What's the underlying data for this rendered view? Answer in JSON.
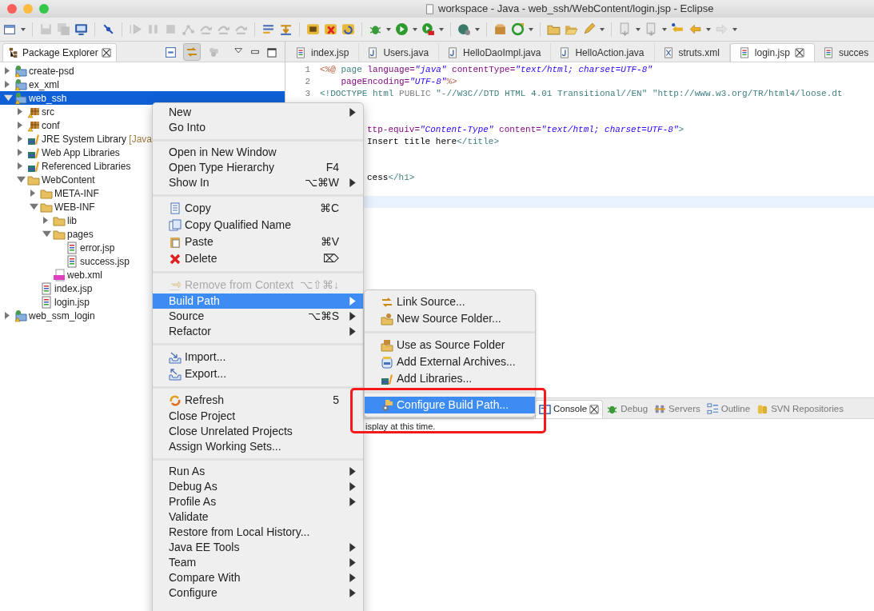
{
  "window": {
    "title": "workspace - Java - web_ssh/WebContent/login.jsp - Eclipse"
  },
  "package_explorer": {
    "title": "Package Explorer",
    "link_with_editor_on": true,
    "tree": [
      {
        "label": "create-psd",
        "kind": "project",
        "expanded": false,
        "selected": false
      },
      {
        "label": "ex_xml",
        "kind": "project",
        "expanded": false,
        "selected": false
      },
      {
        "label": "web_ssh",
        "kind": "project",
        "expanded": true,
        "selected": true,
        "children": [
          {
            "label": "src",
            "kind": "package-folder",
            "expanded": false,
            "selected": false
          },
          {
            "label": "conf",
            "kind": "package-folder",
            "expanded": false,
            "selected": false
          },
          {
            "label": "JRE System Library",
            "note": "[Java",
            "kind": "library",
            "expanded": false,
            "selected": false
          },
          {
            "label": "Web App Libraries",
            "kind": "library",
            "expanded": false,
            "selected": false
          },
          {
            "label": "Referenced Libraries",
            "kind": "library",
            "expanded": false,
            "selected": false
          },
          {
            "label": "WebContent",
            "kind": "folder",
            "expanded": true,
            "selected": false,
            "children": [
              {
                "label": "META-INF",
                "kind": "folder",
                "expanded": false,
                "selected": false
              },
              {
                "label": "WEB-INF",
                "kind": "folder",
                "expanded": true,
                "selected": false,
                "children": [
                  {
                    "label": "lib",
                    "kind": "folder",
                    "expanded": false,
                    "selected": false
                  },
                  {
                    "label": "pages",
                    "kind": "folder",
                    "expanded": true,
                    "selected": false,
                    "children": [
                      {
                        "label": "error.jsp",
                        "kind": "jsp",
                        "selected": false
                      },
                      {
                        "label": "success.jsp",
                        "kind": "jsp",
                        "selected": false
                      }
                    ]
                  },
                  {
                    "label": "web.xml",
                    "kind": "xml",
                    "selected": false
                  }
                ]
              },
              {
                "label": "index.jsp",
                "kind": "jsp",
                "selected": false
              },
              {
                "label": "login.jsp",
                "kind": "jsp",
                "selected": false
              }
            ]
          }
        ]
      },
      {
        "label": "web_ssm_login",
        "kind": "project",
        "expanded": false,
        "selected": false
      }
    ]
  },
  "editor": {
    "tabs": [
      {
        "label": "index.jsp",
        "kind": "jsp",
        "selected": false
      },
      {
        "label": "Users.java",
        "kind": "java",
        "selected": false
      },
      {
        "label": "HelloDaoImpl.java",
        "kind": "java",
        "selected": false
      },
      {
        "label": "HelloAction.java",
        "kind": "java",
        "selected": false
      },
      {
        "label": "struts.xml",
        "kind": "xml",
        "selected": false
      },
      {
        "label": "login.jsp",
        "kind": "jsp",
        "selected": true
      },
      {
        "label": "succes",
        "kind": "jsp",
        "selected": false
      }
    ],
    "lines": [
      {
        "number": "1",
        "kind": "full",
        "current": false,
        "tokens": [
          {
            "text": "<%@",
            "kind": "directive"
          },
          {
            "text": " page",
            "kind": "tag"
          },
          {
            "text": " language=",
            "kind": "attr"
          },
          {
            "text": "\"java\"",
            "kind": "value"
          },
          {
            "text": " contentType=",
            "kind": "attr"
          },
          {
            "text": "\"text/html; charset=UTF-8\"",
            "kind": "value"
          }
        ]
      },
      {
        "number": "2",
        "kind": "full",
        "current": false,
        "tokens": [
          {
            "text": "    pageEncoding=",
            "kind": "attr"
          },
          {
            "text": "\"UTF-8\"",
            "kind": "value"
          },
          {
            "text": "%>",
            "kind": "directive"
          }
        ]
      },
      {
        "number": "3",
        "kind": "full",
        "current": false,
        "tokens": [
          {
            "text": "<!DOCTYPE html ",
            "kind": "tag"
          },
          {
            "text": "PUBLIC",
            "kind": "keyword"
          },
          {
            "text": " \"-//W3C//DTD HTML 4.01 Transitional//EN\" \"http://www.w3.org/TR/html4/loose.dt",
            "kind": "tag"
          }
        ]
      },
      {
        "kind": "blank",
        "current": false
      },
      {
        "kind": "blank",
        "current": false
      },
      {
        "kind": "partial",
        "current": false,
        "tokens": [
          {
            "text": "ttp-equiv=",
            "kind": "attr"
          },
          {
            "text": "\"Content-Type\"",
            "kind": "value"
          },
          {
            "text": " content=",
            "kind": "attr"
          },
          {
            "text": "\"text/html; charset=UTF-8\"",
            "kind": "value"
          },
          {
            "text": ">",
            "kind": "tag"
          }
        ]
      },
      {
        "kind": "partial",
        "current": false,
        "tokens": [
          {
            "text": "Insert title here",
            "kind": "plain"
          },
          {
            "text": "</title>",
            "kind": "tag"
          }
        ]
      },
      {
        "kind": "blank",
        "current": false
      },
      {
        "kind": "blank",
        "current": false
      },
      {
        "kind": "partial",
        "current": false,
        "tokens": [
          {
            "text": "cess",
            "kind": "plain"
          },
          {
            "text": "</h1>",
            "kind": "tag"
          }
        ]
      },
      {
        "kind": "blank",
        "current": false
      },
      {
        "kind": "blank",
        "current": true
      }
    ]
  },
  "bottom_panel": {
    "tabs": [
      {
        "label": "Console",
        "kind": "console",
        "selected": true
      },
      {
        "label": "Debug",
        "kind": "debug",
        "selected": false
      },
      {
        "label": "Servers",
        "kind": "servers",
        "selected": false
      },
      {
        "label": "Outline",
        "kind": "outline",
        "selected": false
      },
      {
        "label": "SVN Repositories",
        "kind": "svn",
        "selected": false
      }
    ],
    "message": "isplay at this time."
  },
  "context_menu": {
    "groups": [
      [
        {
          "label": "New",
          "submenu": true,
          "disabled": false,
          "selected": false
        },
        {
          "label": "Go Into",
          "submenu": false,
          "disabled": false,
          "selected": false
        }
      ],
      [
        {
          "label": "Open in New Window",
          "submenu": false,
          "disabled": false,
          "selected": false
        },
        {
          "label": "Open Type Hierarchy",
          "shortcut": "F4",
          "submenu": false,
          "disabled": false,
          "selected": false
        },
        {
          "label": "Show In",
          "shortcut": "⌥⌘W",
          "submenu": true,
          "disabled": false,
          "selected": false
        }
      ],
      [
        {
          "label": "Copy",
          "shortcut": "⌘C",
          "submenu": false,
          "disabled": false,
          "selected": false
        },
        {
          "label": "Copy Qualified Name",
          "submenu": false,
          "disabled": false,
          "selected": false
        },
        {
          "label": "Paste",
          "shortcut": "⌘V",
          "submenu": false,
          "disabled": false,
          "selected": false
        },
        {
          "label": "Delete",
          "shortcut": "⌦",
          "submenu": false,
          "disabled": false,
          "selected": false
        }
      ],
      [
        {
          "label": "Remove from Context",
          "shortcut": "⌥⇧⌘↓",
          "submenu": false,
          "disabled": true,
          "selected": false
        },
        {
          "label": "Build Path",
          "submenu": true,
          "disabled": false,
          "selected": true
        },
        {
          "label": "Source",
          "shortcut": "⌥⌘S",
          "submenu": true,
          "disabled": false,
          "selected": false
        },
        {
          "label": "Refactor",
          "submenu": true,
          "disabled": false,
          "selected": false
        }
      ],
      [
        {
          "label": "Import...",
          "submenu": false,
          "disabled": false,
          "selected": false
        },
        {
          "label": "Export...",
          "submenu": false,
          "disabled": false,
          "selected": false
        }
      ],
      [
        {
          "label": "Refresh",
          "shortcut": "5",
          "submenu": false,
          "disabled": false,
          "selected": false
        },
        {
          "label": "Close Project",
          "submenu": false,
          "disabled": false,
          "selected": false
        },
        {
          "label": "Close Unrelated Projects",
          "submenu": false,
          "disabled": false,
          "selected": false
        },
        {
          "label": "Assign Working Sets...",
          "submenu": false,
          "disabled": false,
          "selected": false
        }
      ],
      [
        {
          "label": "Run As",
          "submenu": true,
          "disabled": false,
          "selected": false
        },
        {
          "label": "Debug As",
          "submenu": true,
          "disabled": false,
          "selected": false
        },
        {
          "label": "Profile As",
          "submenu": true,
          "disabled": false,
          "selected": false
        },
        {
          "label": "Validate",
          "submenu": false,
          "disabled": false,
          "selected": false
        },
        {
          "label": "Restore from Local History...",
          "submenu": false,
          "disabled": false,
          "selected": false
        },
        {
          "label": "Java EE Tools",
          "submenu": true,
          "disabled": false,
          "selected": false
        },
        {
          "label": "Team",
          "submenu": true,
          "disabled": false,
          "selected": false
        },
        {
          "label": "Compare With",
          "submenu": true,
          "disabled": false,
          "selected": false
        },
        {
          "label": "Configure",
          "submenu": true,
          "disabled": false,
          "selected": false
        }
      ]
    ]
  },
  "build_path_submenu": {
    "groups": [
      [
        {
          "label": "Link Source...",
          "selected": false
        },
        {
          "label": "New Source Folder...",
          "selected": false
        }
      ],
      [
        {
          "label": "Use as Source Folder",
          "selected": false
        },
        {
          "label": "Add External Archives...",
          "selected": false
        },
        {
          "label": "Add Libraries...",
          "selected": false
        }
      ],
      [
        {
          "label": "Configure Build Path...",
          "selected": true
        }
      ]
    ]
  }
}
